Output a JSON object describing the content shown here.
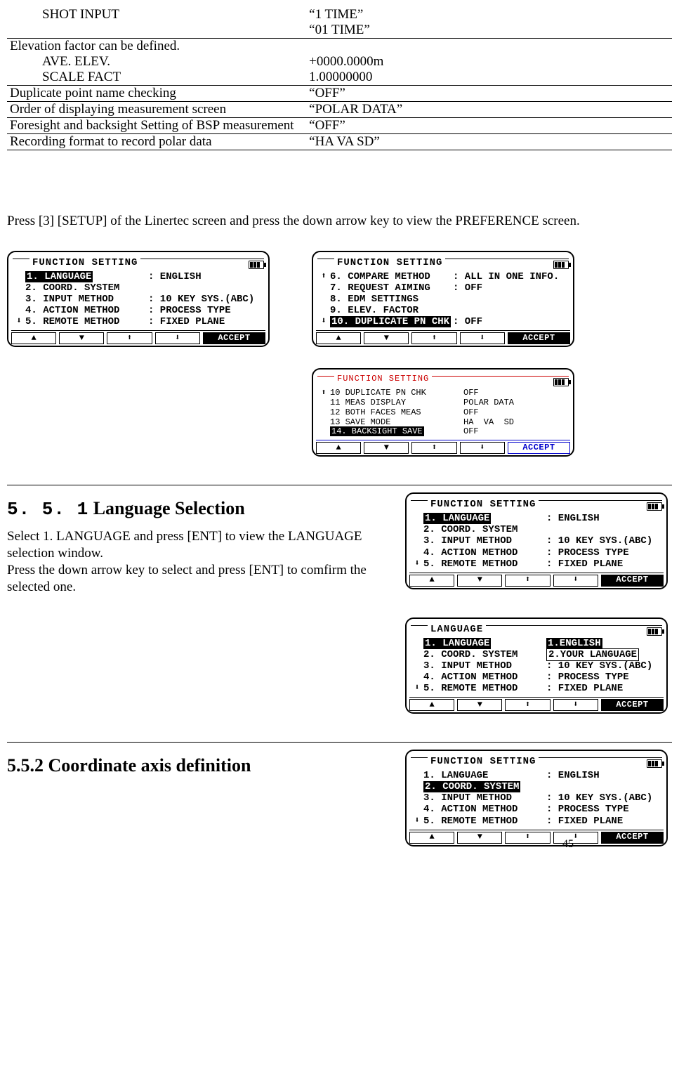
{
  "table": {
    "r0_label": "SHOT INPUT",
    "r0_v1": "“1 TIME”",
    "r0_v2": "“01 TIME”",
    "r1_label": "Elevation factor can be defined.",
    "r1a_label": "AVE. ELEV.",
    "r1a_val": "+0000.0000m",
    "r1b_label": "SCALE FACT",
    "r1b_val": "1.00000000",
    "r2_label": "Duplicate point name checking",
    "r2_val": "“OFF”",
    "r3_label": "Order of displaying measurement screen",
    "r3_val": "“POLAR DATA”",
    "r4_label": "Foresight and backsight Setting of BSP measurement",
    "r4_val": "“OFF”",
    "r5_label": "Recording format to record polar data",
    "r5_val": "“HA VA SD”"
  },
  "para1": "Press [3] [SETUP] of the Linertec screen and press the down arrow key to view the PREFERENCE screen.",
  "screenA": {
    "title": "FUNCTION SETTING",
    "rows": [
      {
        "arrow": "",
        "item": "1. LANGUAGE",
        "hl": true,
        "val": ": ENGLISH"
      },
      {
        "arrow": "",
        "item": "2. COORD. SYSTEM",
        "val": ""
      },
      {
        "arrow": "",
        "item": "3. INPUT METHOD",
        "val": ": 10 KEY SYS.(ABC)"
      },
      {
        "arrow": "",
        "item": "4. ACTION METHOD",
        "val": ": PROCESS TYPE"
      },
      {
        "arrow": "⬇",
        "item": "5. REMOTE METHOD",
        "val": ": FIXED PLANE"
      }
    ],
    "accept": "ACCEPT"
  },
  "screenB": {
    "title": "FUNCTION SETTING",
    "rows": [
      {
        "arrow": "⬆",
        "item": "6. COMPARE METHOD",
        "val": ": ALL IN ONE INFO."
      },
      {
        "arrow": "",
        "item": "7. REQUEST AIMING",
        "val": ": OFF"
      },
      {
        "arrow": "",
        "item": "8. EDM SETTINGS",
        "val": ""
      },
      {
        "arrow": "",
        "item": "9. ELEV. FACTOR",
        "val": ""
      },
      {
        "arrow": "⬇",
        "item": "10. DUPLICATE PN CHK",
        "hl": true,
        "val": ": OFF"
      }
    ],
    "accept": "ACCEPT"
  },
  "screenC": {
    "title": "FUNCTION SETTING",
    "rows": [
      {
        "arrow": "⬆",
        "item": "10 DUPLICATE PN CHK",
        "val": "OFF"
      },
      {
        "arrow": "",
        "item": "11 MEAS DISPLAY",
        "val": "POLAR DATA"
      },
      {
        "arrow": "",
        "item": "12 BOTH FACES MEAS",
        "val": "OFF"
      },
      {
        "arrow": "",
        "item": "13 SAVE MODE",
        "val": "HA  VA  SD"
      },
      {
        "arrow": "",
        "item": "14. BACKSIGHT SAVE",
        "hl": true,
        "val": "OFF"
      }
    ],
    "accept": "ACCEPT"
  },
  "sec551": {
    "num": "5. 5. 1",
    "title": "Language Selection",
    "body": "Select 1. LANGUAGE and press [ENT] to view the LANGUAGE selection window.\nPress the down arrow key to select and press [ENT] to comfirm the selected one."
  },
  "screenD_title": "FUNCTION SETTING",
  "screenE": {
    "title": "LANGUAGE",
    "rows": [
      {
        "arrow": "",
        "item": "1. LANGUAGE",
        "hl": true,
        "opt": "1.ENGLISH",
        "optHl": true
      },
      {
        "arrow": "",
        "item": "2. COORD. SYSTEM",
        "opt": "2.YOUR LANGUAGE"
      },
      {
        "arrow": "",
        "item": "3. INPUT METHOD",
        "val": ": 10 KEY SYS.(ABC)"
      },
      {
        "arrow": "",
        "item": "4. ACTION METHOD",
        "val": ": PROCESS TYPE"
      },
      {
        "arrow": "⬇",
        "item": "5. REMOTE METHOD",
        "val": ": FIXED PLANE"
      }
    ],
    "accept": "ACCEPT"
  },
  "sec552": {
    "title": "5.5.2 Coordinate axis definition"
  },
  "screenF": {
    "title": "FUNCTION SETTING",
    "rows": [
      {
        "arrow": "",
        "item": "1. LANGUAGE",
        "val": ": ENGLISH"
      },
      {
        "arrow": "",
        "item": "2. COORD. SYSTEM",
        "hl": true,
        "val": ""
      },
      {
        "arrow": "",
        "item": "3. INPUT METHOD",
        "val": ": 10 KEY SYS.(ABC)"
      },
      {
        "arrow": "",
        "item": "4. ACTION METHOD",
        "val": ": PROCESS TYPE"
      },
      {
        "arrow": "⬇",
        "item": "5. REMOTE METHOD",
        "val": ": FIXED PLANE"
      }
    ],
    "accept": "ACCEPT"
  },
  "page_no": "45",
  "fkeys": {
    "up": "▲",
    "down": "▼",
    "pu": "⬆",
    "pd": "⬇"
  }
}
